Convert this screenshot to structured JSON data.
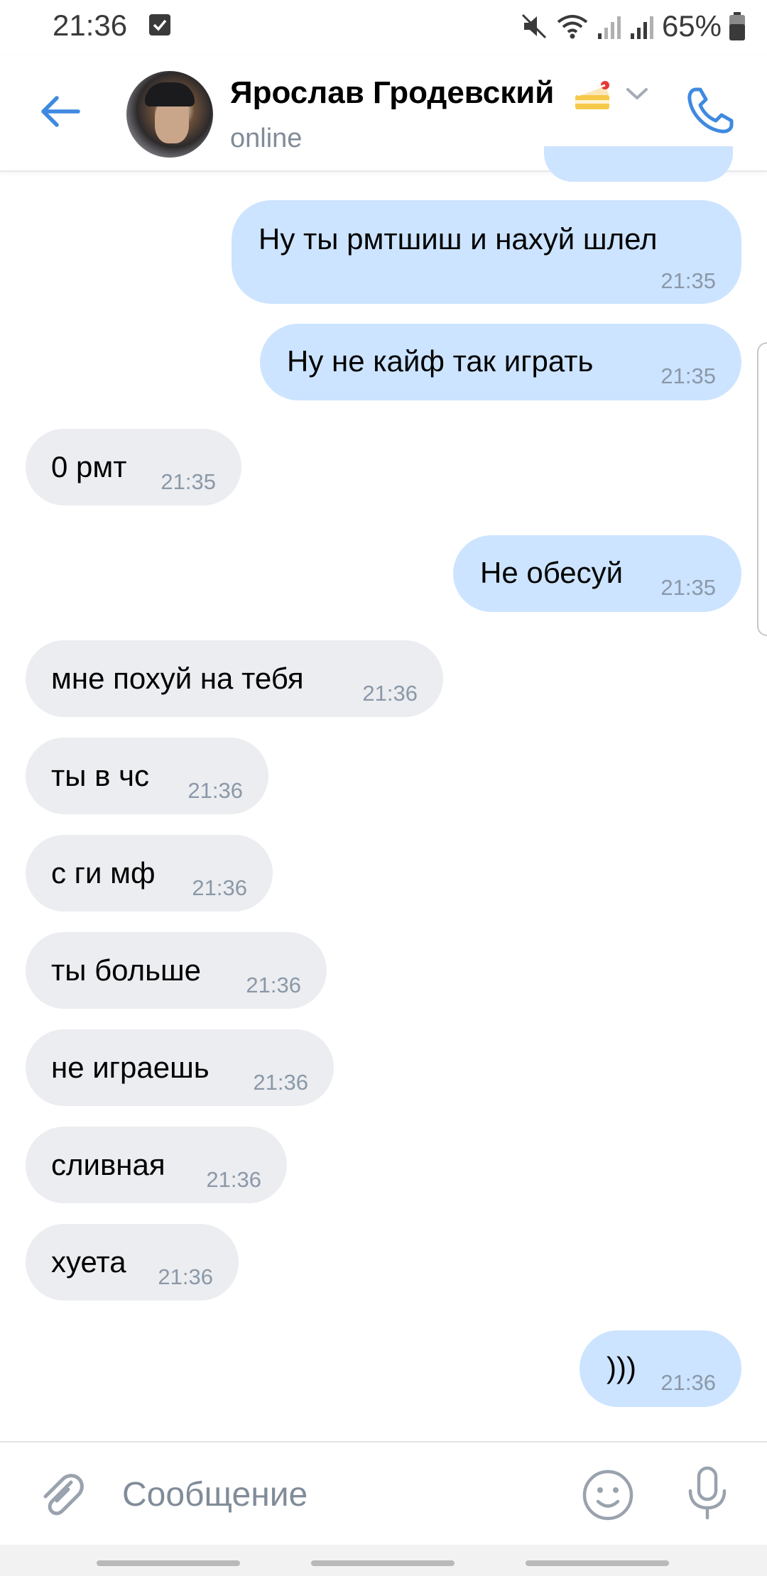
{
  "status_bar": {
    "time": "21:36",
    "battery": "65%"
  },
  "header": {
    "name": "Ярослав Гродевский",
    "status": "online"
  },
  "messages": [
    {
      "dir": "out",
      "text": "Ну ты рмтшиш и нахуй шлел",
      "time": "21:35"
    },
    {
      "dir": "out",
      "text": "Ну не кайф так играть",
      "time": "21:35"
    },
    {
      "dir": "in",
      "text": "0 рмт",
      "time": "21:35"
    },
    {
      "dir": "out",
      "text": "Не обесуй",
      "time": "21:35"
    },
    {
      "dir": "in",
      "text": "мне похуй на тебя",
      "time": "21:36"
    },
    {
      "dir": "in",
      "text": "ты в чс",
      "time": "21:36"
    },
    {
      "dir": "in",
      "text": "с ги мф",
      "time": "21:36"
    },
    {
      "dir": "in",
      "text": "ты больше",
      "time": "21:36"
    },
    {
      "dir": "in",
      "text": "не играешь",
      "time": "21:36"
    },
    {
      "dir": "in",
      "text": "сливная",
      "time": "21:36"
    },
    {
      "dir": "in",
      "text": "хуета",
      "time": "21:36"
    },
    {
      "dir": "out",
      "text": ")))",
      "time": "21:36"
    }
  ],
  "composer": {
    "placeholder": "Сообщение"
  },
  "colors": {
    "accent": "#3f8ae0",
    "outgoing_bubble": "#cce4ff",
    "incoming_bubble": "#ebedf0"
  },
  "icons": [
    "back-arrow-icon",
    "cake-emoji-icon",
    "chevron-down-icon",
    "phone-icon",
    "paperclip-icon",
    "smile-icon",
    "microphone-icon"
  ]
}
